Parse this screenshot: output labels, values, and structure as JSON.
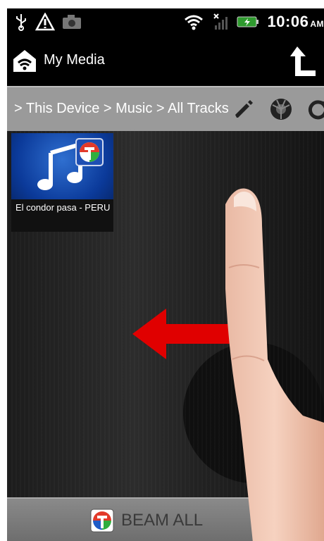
{
  "status_bar": {
    "left_icons": [
      "usb-icon",
      "warning-icon",
      "camera-icon"
    ],
    "right_icons": [
      "wifi-icon",
      "signal-icon",
      "battery-icon"
    ],
    "time": "10:06",
    "ampm": "AM"
  },
  "header": {
    "title": "My Media",
    "home_icon": "home-wifi-icon",
    "up_icon": "up-arrow-icon"
  },
  "breadcrumb": {
    "path": "> This Device > Music > All Tracks",
    "actions": [
      "edit-icon",
      "beam-icon",
      "refresh-icon"
    ]
  },
  "media": {
    "items": [
      {
        "title": "El condor pasa - PERU",
        "icon": "music-notes-icon"
      }
    ]
  },
  "gesture": {
    "direction_icon": "swipe-left-arrow-icon",
    "hand_icon": "finger-icon"
  },
  "bottom_bar": {
    "beam_all_label": "BEAM ALL"
  },
  "colors": {
    "bar_gray": "#9a9a9a",
    "arrow_red": "#e00000",
    "tile_blue": "#0b3a9a"
  }
}
